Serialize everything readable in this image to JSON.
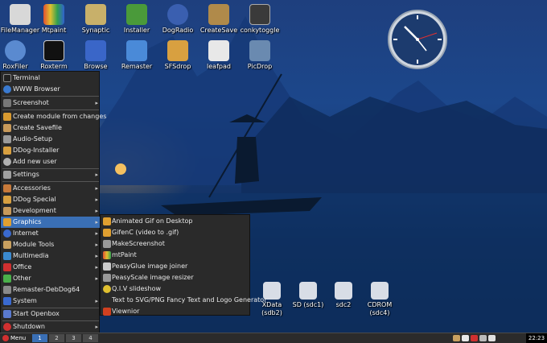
{
  "desktop_icons": [
    {
      "label": "FileManager",
      "icon": "file-manager-icon",
      "color": "#d8d8d8"
    },
    {
      "label": "Mtpaint",
      "icon": "paint-icon",
      "color": "#e05030"
    },
    {
      "label": "Synaptic",
      "icon": "package-icon",
      "color": "#c8b06a"
    },
    {
      "label": "Installer",
      "icon": "installer-icon",
      "color": "#4a9a3a"
    },
    {
      "label": "DogRadio",
      "icon": "headphones-icon",
      "color": "#3a5fb0"
    },
    {
      "label": "CreateSave",
      "icon": "save-box-icon",
      "color": "#b08a4a"
    },
    {
      "label": "conkytoggle",
      "icon": "monitor-graph-icon",
      "color": "#3a3a3a"
    },
    {
      "label": "RoxFiler",
      "icon": "gear-icon",
      "color": "#5a8ad0"
    },
    {
      "label": "Roxterm",
      "icon": "terminal-icon",
      "color": "#111111"
    },
    {
      "label": "Browse",
      "icon": "browse-icon",
      "color": "#3a66c8"
    },
    {
      "label": "Remaster",
      "icon": "remaster-icon",
      "color": "#4a8ad8"
    },
    {
      "label": "SFSdrop",
      "icon": "sfs-icon",
      "color": "#d8a040"
    },
    {
      "label": "leafpad",
      "icon": "notepad-icon",
      "color": "#e8e8e8"
    },
    {
      "label": "PicDrop",
      "icon": "picture-icon",
      "color": "#6a8ab0"
    }
  ],
  "drive_icons": [
    {
      "label": "XData",
      "sub": "(sdb2)"
    },
    {
      "label": "SD (sdc1)",
      "sub": ""
    },
    {
      "label": "sdc2",
      "sub": ""
    },
    {
      "label": "CDROM",
      "sub": "(sdc4)"
    }
  ],
  "menu": {
    "items": [
      {
        "label": "Terminal",
        "icon": "terminal-icon",
        "color": "#222222",
        "arrow": ""
      },
      {
        "label": "WWW Browser",
        "icon": "globe-icon",
        "color": "#3a7ad0",
        "arrow": ""
      },
      {
        "label": "Screenshot",
        "icon": "screenshot-icon",
        "color": "#777777",
        "arrow": "▸"
      },
      {
        "label": "Create module from changes",
        "icon": "module-icon",
        "color": "#d89a30",
        "arrow": ""
      },
      {
        "label": "Create Savefile",
        "icon": "savefile-icon",
        "color": "#c89a5a",
        "arrow": ""
      },
      {
        "label": "Audio-Setup",
        "icon": "audio-icon",
        "color": "#9a9a9a",
        "arrow": ""
      },
      {
        "label": "DDog-Installer",
        "icon": "installer-icon",
        "color": "#d8a040",
        "arrow": ""
      },
      {
        "label": "Add new user",
        "icon": "user-icon",
        "color": "#b0b0b0",
        "arrow": ""
      },
      {
        "label": "Settings",
        "icon": "wrench-icon",
        "color": "#a0a0a0",
        "arrow": "▸"
      },
      {
        "label": "Accessories",
        "icon": "accessories-icon",
        "color": "#c87a3a",
        "arrow": "▸"
      },
      {
        "label": "DDog Special",
        "icon": "special-icon",
        "color": "#d8a040",
        "arrow": "▸"
      },
      {
        "label": "Development",
        "icon": "development-icon",
        "color": "#c89a5a",
        "arrow": "▸"
      },
      {
        "label": "Graphics",
        "icon": "graphics-icon",
        "color": "#e0a030",
        "arrow": "▸"
      },
      {
        "label": "Internet",
        "icon": "internet-icon",
        "color": "#3a6ad0",
        "arrow": "▸"
      },
      {
        "label": "Module Tools",
        "icon": "module-tools-icon",
        "color": "#c8a060",
        "arrow": "▸"
      },
      {
        "label": "Multimedia",
        "icon": "multimedia-icon",
        "color": "#3a8ad0",
        "arrow": "▸"
      },
      {
        "label": "Office",
        "icon": "office-icon",
        "color": "#d03030",
        "arrow": "▸"
      },
      {
        "label": "Other",
        "icon": "other-icon",
        "color": "#4ab04a",
        "arrow": "▸"
      },
      {
        "label": "Remaster-DebDog64",
        "icon": "remaster-icon",
        "color": "#8a8a8a",
        "arrow": ""
      },
      {
        "label": "System",
        "icon": "system-icon",
        "color": "#3a6ad0",
        "arrow": "▸"
      },
      {
        "label": "Start Openbox",
        "icon": "openbox-icon",
        "color": "#5a7ad0",
        "arrow": ""
      },
      {
        "label": "Shutdown",
        "icon": "power-icon",
        "color": "#d03030",
        "arrow": "▸"
      }
    ]
  },
  "submenu": {
    "items": [
      {
        "label": "Animated Gif on Desktop",
        "icon": "gif-icon",
        "color": "#e0a030"
      },
      {
        "label": "GifenC (video to .gif)",
        "icon": "gif-icon",
        "color": "#e0a030"
      },
      {
        "label": "MakeScreenshot",
        "icon": "screenshot-icon",
        "color": "#9a9a9a"
      },
      {
        "label": "mtPaint",
        "icon": "paint-icon",
        "color": "#e05030"
      },
      {
        "label": "PeasyGlue image joiner",
        "icon": "glue-icon",
        "color": "#cccccc"
      },
      {
        "label": "PeasyScale image resizer",
        "icon": "scale-icon",
        "color": "#9a9a9a"
      },
      {
        "label": "Q.I.V slideshow",
        "icon": "slideshow-icon",
        "color": "#e0c030"
      },
      {
        "label": "Text to SVG/PNG Fancy Text and Logo Generator",
        "icon": "",
        "color": ""
      },
      {
        "label": "Viewnior",
        "icon": "viewnior-icon",
        "color": "#d04020"
      }
    ]
  },
  "taskbar": {
    "menu_label": "Menu",
    "workspaces": [
      "1",
      "2",
      "3",
      "4"
    ],
    "active_workspace": "1",
    "time": "22:23"
  }
}
